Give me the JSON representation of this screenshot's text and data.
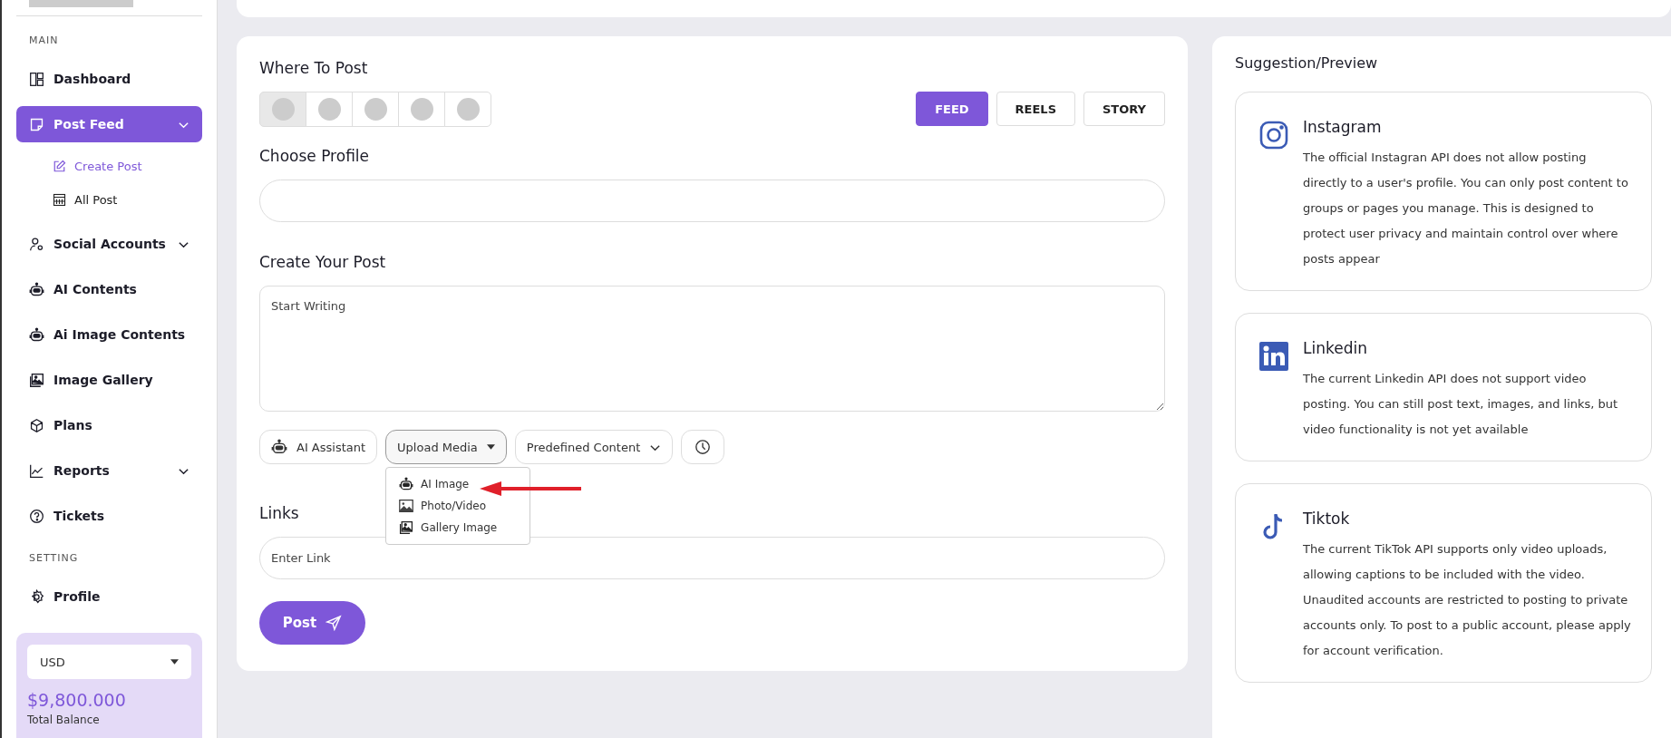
{
  "sidebar": {
    "sections": [
      {
        "heading": "MAIN",
        "items": [
          {
            "label": "Dashboard",
            "selected": false,
            "has_caret": false
          },
          {
            "label": "Post Feed",
            "selected": true,
            "has_caret": true,
            "children": [
              {
                "label": "Create Post",
                "selected": true
              },
              {
                "label": "All Post",
                "selected": false
              }
            ]
          },
          {
            "label": "Social Accounts",
            "selected": false,
            "has_caret": true
          },
          {
            "label": "AI Contents",
            "selected": false,
            "has_caret": false
          },
          {
            "label": "Ai Image Contents",
            "selected": false,
            "has_caret": false
          },
          {
            "label": "Image Gallery",
            "selected": false,
            "has_caret": false
          },
          {
            "label": "Plans",
            "selected": false,
            "has_caret": false
          },
          {
            "label": "Reports",
            "selected": false,
            "has_caret": true
          },
          {
            "label": "Tickets",
            "selected": false,
            "has_caret": false
          }
        ]
      },
      {
        "heading": "SETTING",
        "items": [
          {
            "label": "Profile",
            "selected": false,
            "has_caret": false
          }
        ]
      }
    ],
    "balance": {
      "currency": "USD",
      "amount": "$9,800.000",
      "label": "Total Balance"
    }
  },
  "post_form": {
    "where_title": "Where To Post",
    "profiles": [
      {
        "selected": true
      },
      {
        "selected": false
      },
      {
        "selected": false
      },
      {
        "selected": false
      },
      {
        "selected": false
      }
    ],
    "post_types": [
      {
        "label": "FEED",
        "selected": true
      },
      {
        "label": "REELS",
        "selected": false
      },
      {
        "label": "STORY",
        "selected": false
      }
    ],
    "choose_profile_title": "Choose Profile",
    "create_title": "Create Your Post",
    "post_placeholder": "Start Writing",
    "tools": [
      {
        "kind": "icon-button",
        "label": "AI Assistant"
      },
      {
        "kind": "dropdown",
        "label": "Upload Media",
        "expanded": true,
        "menu": [
          {
            "label": "AI Image"
          },
          {
            "label": "Photo/Video"
          },
          {
            "label": "Gallery Image"
          }
        ]
      },
      {
        "kind": "select",
        "label": "Predefined Content"
      },
      {
        "kind": "clock"
      }
    ],
    "links_title": "Links",
    "link_placeholder": "Enter Link",
    "submit": "Post"
  },
  "preview": {
    "title": "Suggestion/Preview",
    "cards": [
      {
        "kind": "instagram",
        "name": "Instagram",
        "text": "The official Instagran API does not allow posting directly to a user's profile. You can only post content to groups or pages you manage. This is designed to protect user privacy and maintain control over where posts appear"
      },
      {
        "kind": "linkedin",
        "name": "Linkedin",
        "text": "The current Linkedin API does not support video posting. You can still post text, images, and links, but video functionality is not yet available"
      },
      {
        "kind": "tiktok",
        "name": "Tiktok",
        "text": "The current TikTok API supports only video uploads, allowing captions to be included with the video. Unaudited accounts are restricted to posting to private accounts only. To post to a public account, please apply for account verification."
      }
    ]
  }
}
